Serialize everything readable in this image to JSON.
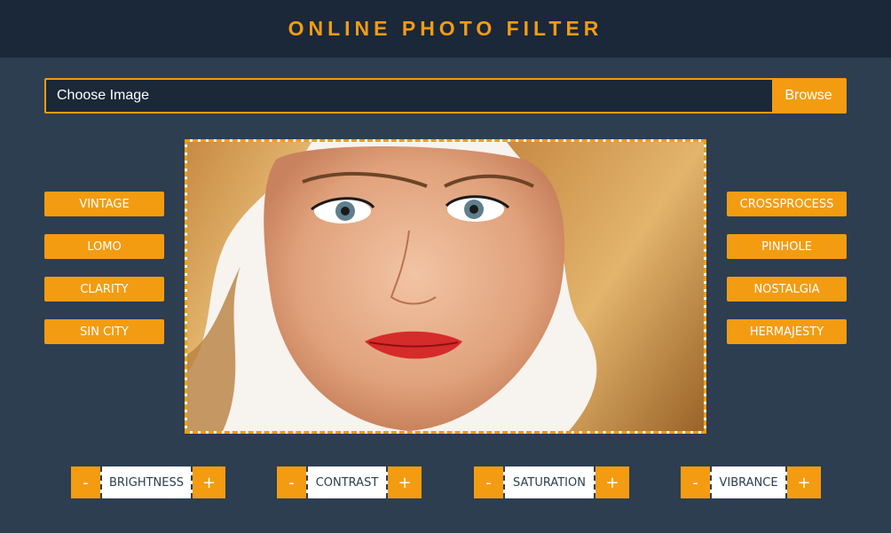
{
  "header": {
    "title": "ONLINE PHOTO FILTER"
  },
  "file_picker": {
    "value": "Choose Image",
    "browse_label": "Browse"
  },
  "filters": {
    "left": [
      "VINTAGE",
      "LOMO",
      "CLARITY",
      "SIN CITY"
    ],
    "right": [
      "CROSSPROCESS",
      "PINHOLE",
      "NOSTALGIA",
      "HERMAJESTY"
    ]
  },
  "adjustments": [
    {
      "label": "BRIGHTNESS",
      "minus": "-",
      "plus": "+"
    },
    {
      "label": "CONTRAST",
      "minus": "-",
      "plus": "+"
    },
    {
      "label": "SATURATION",
      "minus": "-",
      "plus": "+"
    },
    {
      "label": "VIBRANCE",
      "minus": "-",
      "plus": "+"
    }
  ],
  "colors": {
    "accent": "#f39c12",
    "background": "#2c3e50",
    "header": "#1a2839"
  }
}
